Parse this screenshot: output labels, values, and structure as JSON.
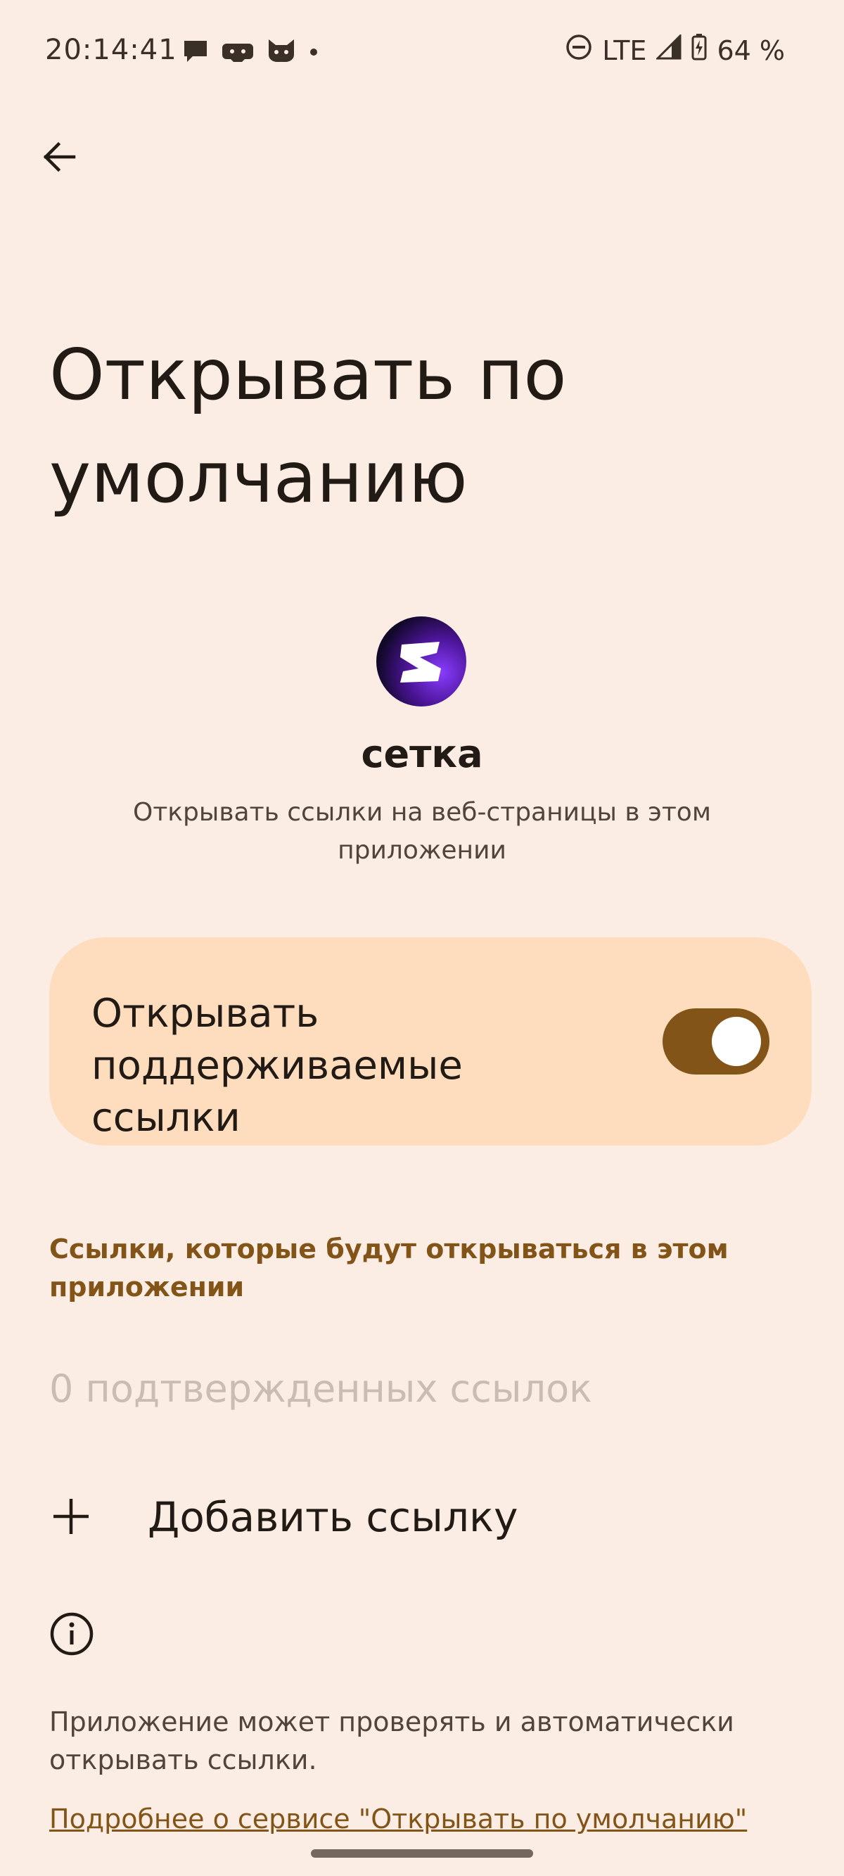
{
  "status_bar": {
    "time": "20:14:41",
    "network": "LTE",
    "battery": "64 %",
    "notification_icons": [
      "chat-bubble-icon",
      "gamepad-icon",
      "cat-icon",
      "dot-icon"
    ],
    "system_icons": [
      "do-not-disturb-icon",
      "signal-icon",
      "battery-charging-icon"
    ]
  },
  "header": {
    "back_icon": "arrow-back-icon",
    "title": "Открывать по умолчанию"
  },
  "app": {
    "name": "сетка",
    "description": "Открывать ссылки на веб-страницы в этом приложении",
    "icon_colors": {
      "outer": "#12082A",
      "inner": "#7A2CF0"
    }
  },
  "toggle": {
    "label": "Открывать поддерживаемые ссылки",
    "checked": true,
    "track_color": "#835418",
    "card_color": "#FEDDBE"
  },
  "links_section": {
    "header": "Ссылки, которые будут открываться в этом приложении",
    "empty_state": "0 подтвержденных ссылок",
    "add_link_label": "Добавить ссылку"
  },
  "info": {
    "text": "Приложение может проверять и автоматически открывать ссылки.",
    "learn_more": "Подробнее о сервисе \"Открывать по умолчанию\""
  },
  "colors": {
    "background": "#FCEDE4",
    "accent": "#835418",
    "text_primary": "#221A14",
    "text_secondary": "#52443A",
    "text_disabled": "#C9BCB2"
  }
}
